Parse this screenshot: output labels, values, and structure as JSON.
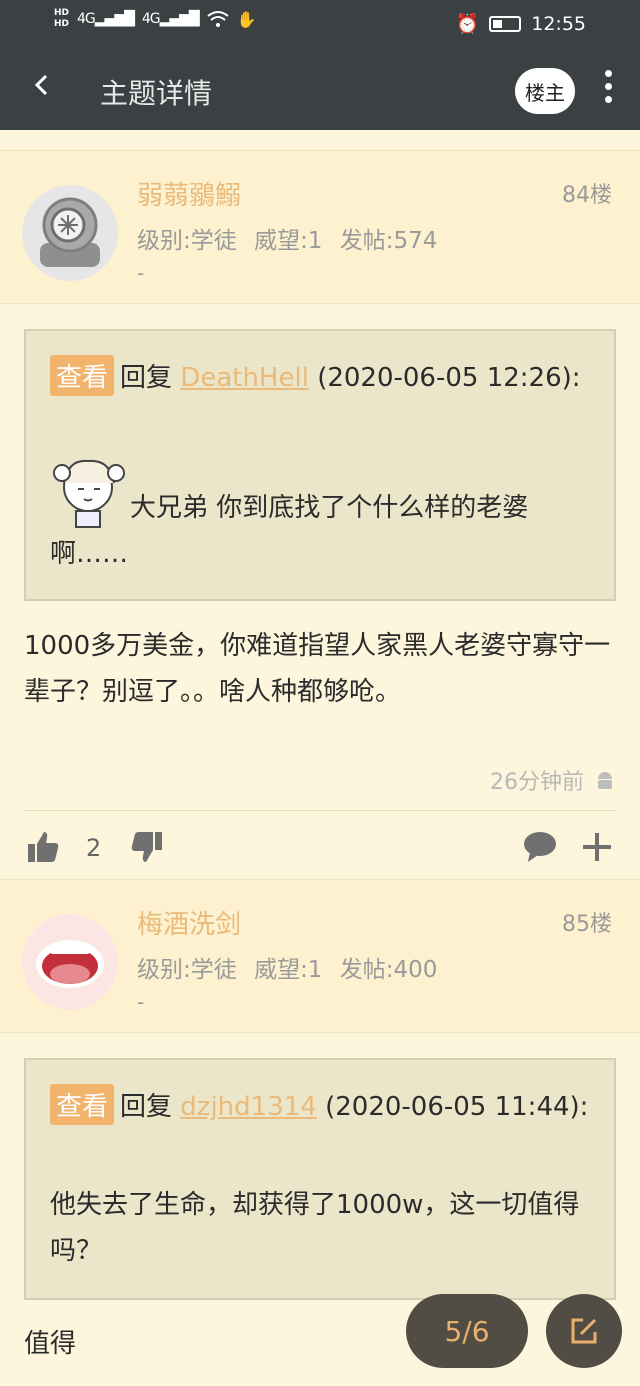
{
  "status_bar": {
    "hd1": "HD",
    "hd2": "HD",
    "net1": "4G",
    "net2": "4G",
    "time": "12:55"
  },
  "app_bar": {
    "back_icon": "chevron-left-icon",
    "title": "主题详情",
    "author_only_label": "楼主",
    "more_icon": "more-vertical-icon"
  },
  "posts": [
    {
      "username": "弱蒻鶸鰯",
      "level": "级别:学徒",
      "prestige": "威望:1",
      "posts_count": "发帖:574",
      "sub": "-",
      "floor": "84楼",
      "quote": {
        "view_label": "查看",
        "reply_word": "回复",
        "reply_user": "DeathHell",
        "reply_time": "(2020-06-05 12:26):",
        "text": "大兄弟 你到底找了个什么样的老婆啊……"
      },
      "content": "1000多万美金，你难道指望人家黑人老婆守寡守一辈子？别逗了。。啥人种都够呛。",
      "time": "26分钟前",
      "likes": "2"
    },
    {
      "username": "梅酒洗剑",
      "level": "级别:学徒",
      "prestige": "威望:1",
      "posts_count": "发帖:400",
      "sub": "-",
      "floor": "85楼",
      "quote": {
        "view_label": "查看",
        "reply_word": "回复",
        "reply_user": "dzjhd1314",
        "reply_time": "(2020-06-05 11:44):",
        "text": "他失去了生命，却获得了1000w，这一切值得吗？"
      },
      "content": "值得"
    }
  ],
  "fab": {
    "page": "5/6",
    "edit_icon": "edit-icon"
  },
  "colors": {
    "app_bar": "#3b4043",
    "background": "#fdf6dd",
    "accent": "#e9ba79",
    "tag": "#f2b36c"
  }
}
